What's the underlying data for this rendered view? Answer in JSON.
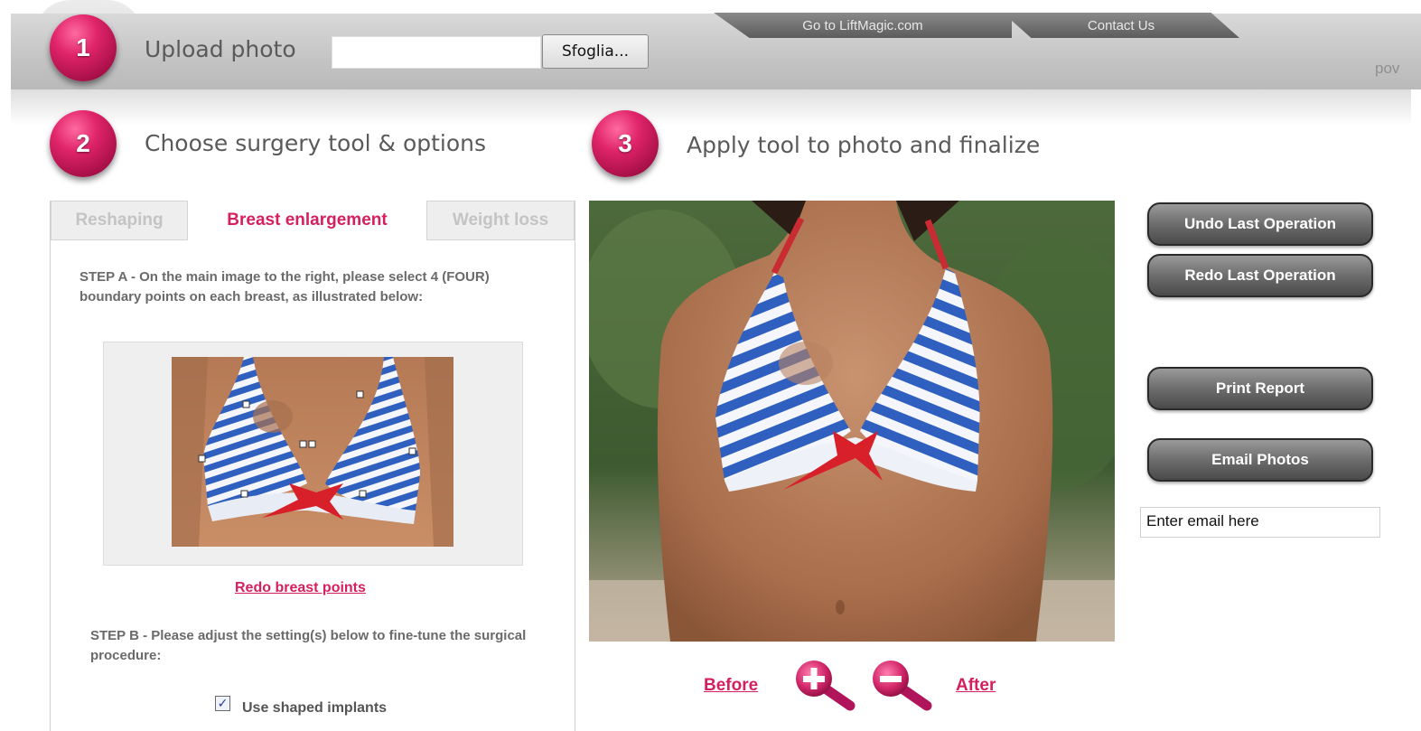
{
  "header": {
    "step1_number": "1",
    "step1_title": "Upload photo",
    "browse_label": "Sfoglia...",
    "nav_liftmagic": "Go to LiftMagic.com",
    "nav_contact": "Contact Us",
    "powered_text": "pov"
  },
  "step2": {
    "number": "2",
    "title": "Choose surgery tool & options"
  },
  "step3": {
    "number": "3",
    "title": "Apply tool to photo and finalize"
  },
  "tabs": [
    {
      "label": "Reshaping",
      "active": false
    },
    {
      "label": "Breast enlargement",
      "active": true
    },
    {
      "label": "Weight loss",
      "active": false
    }
  ],
  "panel": {
    "step_a": "STEP A - On the main image to the right, please select 4 (FOUR) boundary points on each breast, as illustrated below:",
    "redo_points": "Redo breast points",
    "step_b": "STEP B - Please adjust the setting(s) below to fine-tune the surgical procedure:",
    "shaped_implants_label": "Use shaped implants",
    "shaped_implants_checked": true
  },
  "viewer": {
    "before_label": "Before",
    "after_label": "After"
  },
  "actions": {
    "undo": "Undo Last Operation",
    "redo": "Redo Last Operation",
    "print": "Print Report",
    "email_photos": "Email Photos",
    "email_placeholder": "Enter email here"
  },
  "colors": {
    "accent": "#d4205f",
    "button_dark": "#5a5a5a",
    "bikini_blue": "#2f5fbf",
    "bikini_red": "#d8202a"
  }
}
